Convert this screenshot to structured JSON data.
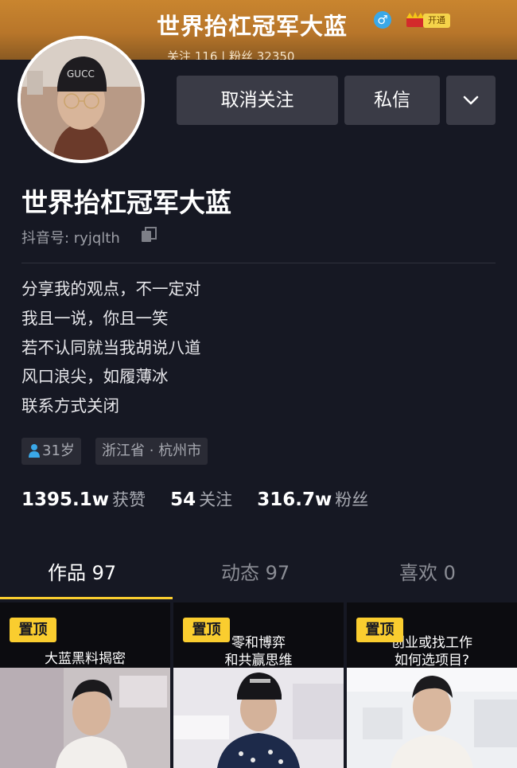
{
  "header": {
    "title": "世界抬杠冠军大蓝",
    "gender_symbol": "♂",
    "crown_icon": "crown-icon",
    "vip_label": "开通",
    "counts_text": "关注 116 | 粉丝 32350"
  },
  "profile": {
    "name": "世界抬杠冠军大蓝",
    "douyin_id": "抖音号: ryjqlth",
    "bio": [
      "分享我的观点，不一定对",
      "我且一说，你且一笑",
      "若不认同就当我胡说八道",
      "风口浪尖，如履薄冰",
      "联系方式关闭"
    ],
    "age_tag": "31岁",
    "location_tag": "浙江省 · 杭州市"
  },
  "actions": {
    "unfollow_label": "取消关注",
    "message_label": "私信",
    "more_icon": "chevron-down-icon"
  },
  "stats": {
    "likes_value": "1395.1w",
    "likes_label": "获赞",
    "following_value": "54",
    "following_label": "关注",
    "followers_value": "316.7w",
    "followers_label": "粉丝"
  },
  "tabs": [
    {
      "label": "作品 97",
      "active": true
    },
    {
      "label": "动态 97",
      "active": false
    },
    {
      "label": "喜欢 0",
      "active": false
    }
  ],
  "videos": [
    {
      "pin": "置顶",
      "caption_lines": [
        "大蓝黑料揭密"
      ]
    },
    {
      "pin": "置顶",
      "caption_lines": [
        "零和博弈",
        "和共赢思维"
      ]
    },
    {
      "pin": "置顶",
      "caption_lines": [
        "创业或找工作",
        "如何选项目?"
      ]
    }
  ],
  "colors": {
    "background": "#161823",
    "accent_yellow": "#facd2f",
    "button_bg": "#3a3b46",
    "header_gold": "#c9852f",
    "gender_blue": "#3aa8e8"
  }
}
